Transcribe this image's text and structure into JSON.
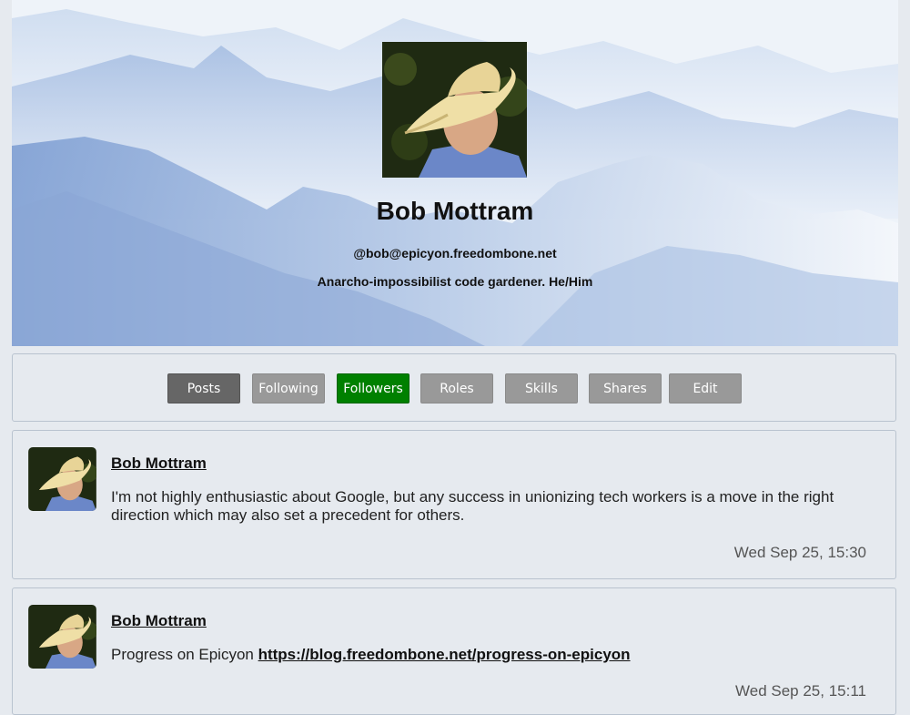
{
  "profile": {
    "name": "Bob Mottram",
    "handle": "@bob@epicyon.freedombone.net",
    "bio": "Anarcho-impossibilist code gardener. He/Him"
  },
  "nav": {
    "posts": "Posts",
    "following": "Following",
    "followers": "Followers",
    "roles": "Roles",
    "skills": "Skills",
    "shares": "Shares",
    "edit": "Edit"
  },
  "colors": {
    "active_tab": "#666666",
    "followers_tab": "#008000",
    "inactive_tab": "#999999"
  },
  "posts": [
    {
      "author": "Bob Mottram",
      "content": "I'm not highly enthusiastic about Google, but any success in unionizing tech workers is a move in the right direction which may also set a precedent for others.",
      "timestamp": "Wed Sep 25, 15:30"
    },
    {
      "author": "Bob Mottram",
      "content_prefix": "Progress on Epicyon ",
      "link": "https://blog.freedombone.net/progress-on-epicyon",
      "timestamp": "Wed Sep 25, 15:11"
    }
  ]
}
